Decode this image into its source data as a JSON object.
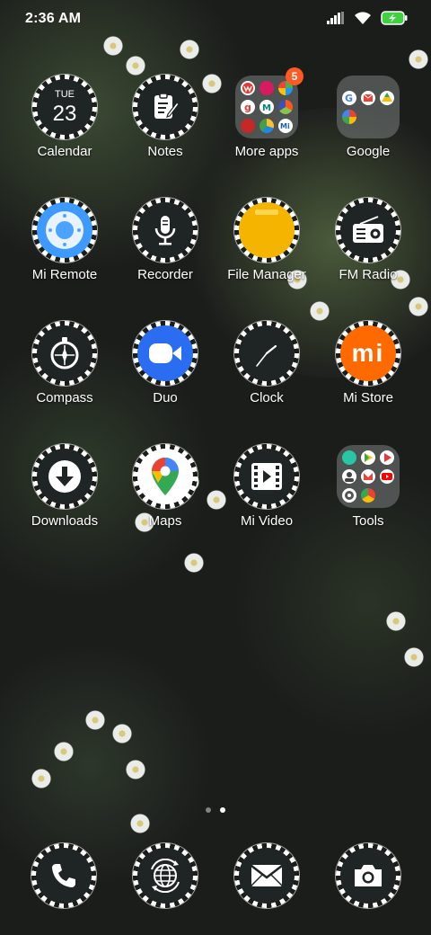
{
  "status_bar": {
    "time": "2:36 AM"
  },
  "calendar": {
    "weekday": "TUE",
    "day": "23"
  },
  "apps": [
    {
      "label": "Calendar"
    },
    {
      "label": "Notes"
    },
    {
      "label": "More apps",
      "badge": "5"
    },
    {
      "label": "Google"
    },
    {
      "label": "Mi Remote"
    },
    {
      "label": "Recorder"
    },
    {
      "label": "File Manager"
    },
    {
      "label": "FM Radio"
    },
    {
      "label": "Compass"
    },
    {
      "label": "Duo"
    },
    {
      "label": "Clock"
    },
    {
      "label": "Mi Store"
    },
    {
      "label": "Downloads"
    },
    {
      "label": "Maps"
    },
    {
      "label": "Mi Video"
    },
    {
      "label": "Tools"
    }
  ],
  "mi_store_logo": "mi",
  "dock": [
    "phone-icon",
    "browser-icon",
    "messaging-icon",
    "camera-icon"
  ],
  "colors": {
    "badge": "#ff5a26",
    "duo": "#2a6df0",
    "mi_store": "#ff6a00",
    "file_manager": "#f5b400",
    "mi_remote": "#4aa3ff"
  }
}
